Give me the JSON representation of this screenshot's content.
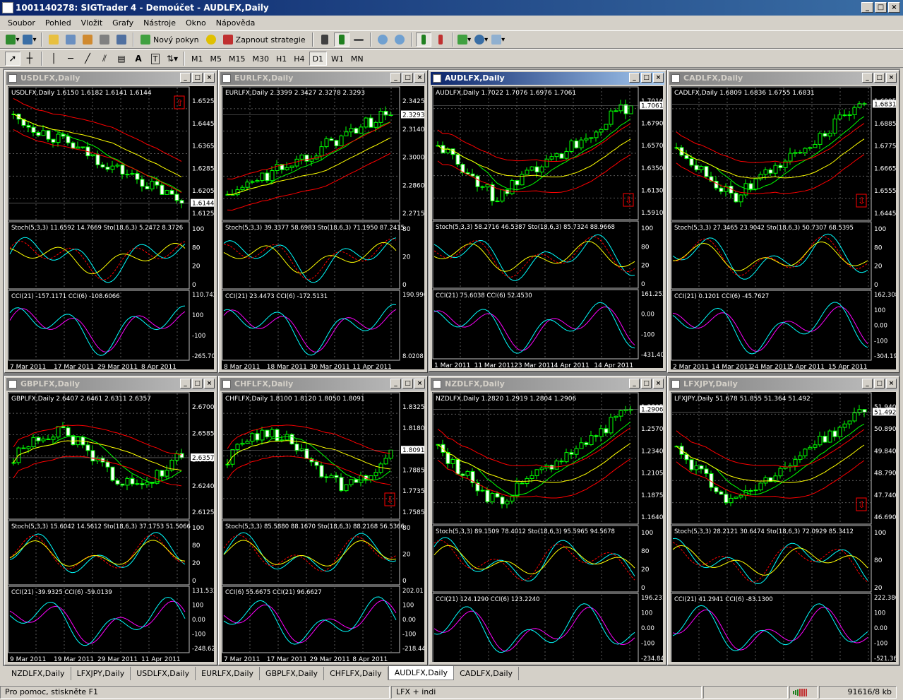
{
  "app": {
    "title": "1001140278: SIGTrader 4 - Demoúčet - AUDLFX,Daily",
    "win_controls": [
      "_",
      "□",
      "×"
    ]
  },
  "menu": [
    "Soubor",
    "Pohled",
    "Vložit",
    "Grafy",
    "Nástroje",
    "Okno",
    "Nápověda"
  ],
  "toolbar": {
    "new_order": "Nový pokyn",
    "auto_trading": "Zapnout strategie"
  },
  "timeframes": [
    "M1",
    "M5",
    "M15",
    "M30",
    "H1",
    "H4",
    "D1",
    "W1",
    "MN"
  ],
  "active_timeframe": "D1",
  "colors": {
    "bull": "#ffffff",
    "bear": "#00ff00",
    "ma_fast": "#00ff00",
    "ma_slow": "#ffff00",
    "band": "#ff0000",
    "stoch_main": "#00ffff",
    "cci": "#ff00ff"
  },
  "charts": [
    {
      "title": "USDLFX,Daily",
      "header": "USDLFX,Daily  1.6150 1.6182 1.6141 1.6144",
      "prices": [
        "1.6525",
        "1.6445",
        "1.6365",
        "1.6285",
        "1.6205",
        "1.6125"
      ],
      "price_tag": "1.6144",
      "trend": "down",
      "stoch_label": "Stoch(5,3,3) 11.6592 14.7669   Sto(18,6,3) 5.2472 8.3726",
      "stoch_scale": [
        "100",
        "80",
        "20",
        "0"
      ],
      "cci_label": "CCI(21) -157.1171   CCI(6) -108.6066",
      "cci_scale": [
        "110.742",
        "100",
        "-100",
        "-265.704"
      ],
      "dates": [
        "7 Mar 2011",
        "17 Mar 2011",
        "29 Mar 2011",
        "8 Apr 2011"
      ],
      "arrow": "up"
    },
    {
      "title": "EURLFX,Daily",
      "header": "EURLFX,Daily  2.3399 2.3427 2.3278 2.3293",
      "prices": [
        "2.3425",
        "2.3140",
        "2.3000",
        "2.2860",
        "2.2715"
      ],
      "price_tag": "2.3293",
      "trend": "up",
      "stoch_label": "Stoch(5,3,3) 39.3377 58.6983   Sto(18,6,3) 71.1950 87.2415",
      "stoch_scale": [
        "80",
        "20",
        "0"
      ],
      "cci_label": "CCI(21) 23.4473   CCI(6) -172.5131",
      "cci_scale": [
        "190.9964",
        "8.0208"
      ],
      "dates": [
        "8 Mar 2011",
        "18 Mar 2011",
        "30 Mar 2011",
        "11 Apr 2011"
      ],
      "arrow": ""
    },
    {
      "title": "AUDLFX,Daily",
      "header": "AUDLFX,Daily  1.7022 1.7076 1.6976 1.7061",
      "prices": [
        "1.7010",
        "1.6790",
        "1.6570",
        "1.6350",
        "1.6130",
        "1.5910"
      ],
      "price_tag": "1.7061",
      "trend": "vshape",
      "stoch_label": "Stoch(5,3,3) 58.2716 46.5387   Sto(18,6,3) 85.7324 88.9668",
      "stoch_scale": [
        "100",
        "80",
        "20",
        "0"
      ],
      "cci_label": "CCI(21) 75.6038   CCI(6) 52.4530",
      "cci_scale": [
        "161.2534",
        "0.00",
        "-100",
        "-431.404"
      ],
      "dates": [
        "1 Mar 2011",
        "11 Mar 2011",
        "23 Mar 2011",
        "4 Apr 2011",
        "14 Apr 2011"
      ],
      "arrow": "down"
    },
    {
      "title": "CADLFX,Daily",
      "header": "CADLFX,Daily  1.6809 1.6836 1.6755 1.6831",
      "prices": [
        "1.6995",
        "1.6885",
        "1.6775",
        "1.6665",
        "1.6555",
        "1.6445"
      ],
      "price_tag": "1.6831",
      "trend": "vshape",
      "stoch_label": "Stoch(5,3,3) 27.3465 23.9042   Sto(18,6,3) 50.7307 68.5395",
      "stoch_scale": [
        "100",
        "80",
        "20",
        "0"
      ],
      "cci_label": "CCI(21) 0.1201   CCI(6) -45.7627",
      "cci_scale": [
        "162.3087",
        "100",
        "0.00",
        "-100",
        "-304.198"
      ],
      "dates": [
        "2 Mar 2011",
        "14 Mar 2011",
        "24 Mar 2011",
        "5 Apr 2011",
        "15 Apr 2011"
      ],
      "arrow": "down"
    },
    {
      "title": "GBPLFX,Daily",
      "header": "GBPLFX,Daily  2.6407 2.6461 2.6311 2.6357",
      "prices": [
        "2.6700",
        "2.6585",
        "2.6470",
        "2.6240",
        "2.6125"
      ],
      "price_tag": "2.6357",
      "trend": "flat",
      "stoch_label": "Stoch(5,3,3) 15.6042 14.5612   Sto(18,6,3) 37.1753 51.5066",
      "stoch_scale": [
        "100",
        "80",
        "20",
        "0"
      ],
      "cci_label": "CCI(21) -39.9325   CCI(6) -59.0139",
      "cci_scale": [
        "131.5337",
        "100",
        "0.00",
        "-100",
        "-248.621"
      ],
      "dates": [
        "9 Mar 2011",
        "19 Mar 2011",
        "29 Mar 2011",
        "11 Apr 2011"
      ],
      "arrow": ""
    },
    {
      "title": "CHFLFX,Daily",
      "header": "CHFLFX,Daily  1.8100 1.8120 1.8050 1.8091",
      "prices": [
        "1.8325",
        "1.8180",
        "1.8035",
        "1.7885",
        "1.7735",
        "1.7585"
      ],
      "price_tag": "1.8091",
      "trend": "flat",
      "stoch_label": "Stoch(5,3,3) 85.5880 88.1670   Sto(18,6,3) 88.2168 56.5366",
      "stoch_scale": [
        "80",
        "20",
        "0"
      ],
      "cci_label": "CCI(6) 55.6675   CCI(21) 96.6627",
      "cci_scale": [
        "202.01",
        "100",
        "0.00",
        "-100",
        "-218.442"
      ],
      "dates": [
        "7 Mar 2011",
        "17 Mar 2011",
        "29 Mar 2011",
        "8 Apr 2011"
      ],
      "arrow": "down"
    },
    {
      "title": "NZDLFX,Daily",
      "header": "NZDLFX,Daily  1.2820 1.2919 1.2804 1.2906",
      "prices": [
        "1.2805",
        "1.2570",
        "1.2340",
        "1.2105",
        "1.1875",
        "1.1640"
      ],
      "price_tag": "1.2906",
      "trend": "vshape",
      "stoch_label": "Stoch(5,3,3) 89.1509 78.4012   Sto(18,6,3) 95.5965 94.5678",
      "stoch_scale": [
        "100",
        "80",
        "20",
        "0"
      ],
      "cci_label": "CCI(21) 124.1290   CCI(6) 123.2240",
      "cci_scale": [
        "196.2311",
        "100",
        "0.00",
        "-100",
        "-234.845"
      ],
      "dates": [],
      "arrow": ""
    },
    {
      "title": "LFXJPY,Daily",
      "header": "LFXJPY,Daily  51.678 51.855 51.364 51.492",
      "prices": [
        "51.940",
        "50.890",
        "49.840",
        "48.790",
        "47.740",
        "46.690"
      ],
      "price_tag": "51.492",
      "trend": "vshape",
      "stoch_label": "Stoch(5,3,3) 28.2121 30.6474   Sto(18,6,3) 72.0929 85.3412",
      "stoch_scale": [
        "100",
        "80",
        "20"
      ],
      "cci_label": "CCI(21) 41.2941   CCI(6) -83.1300",
      "cci_scale": [
        "222.3803",
        "100",
        "0.00",
        "-100",
        "-521.360"
      ],
      "dates": [],
      "arrow": "down"
    }
  ],
  "tabs": [
    "NZDLFX,Daily",
    "LFXJPY,Daily",
    "USDLFX,Daily",
    "EURLFX,Daily",
    "GBPLFX,Daily",
    "CHFLFX,Daily",
    "AUDLFX,Daily",
    "CADLFX,Daily"
  ],
  "active_tab": "AUDLFX,Daily",
  "status": {
    "help": "Pro pomoc, stiskněte F1",
    "profile": "LFX + indi",
    "traffic": "91616/8 kb"
  }
}
